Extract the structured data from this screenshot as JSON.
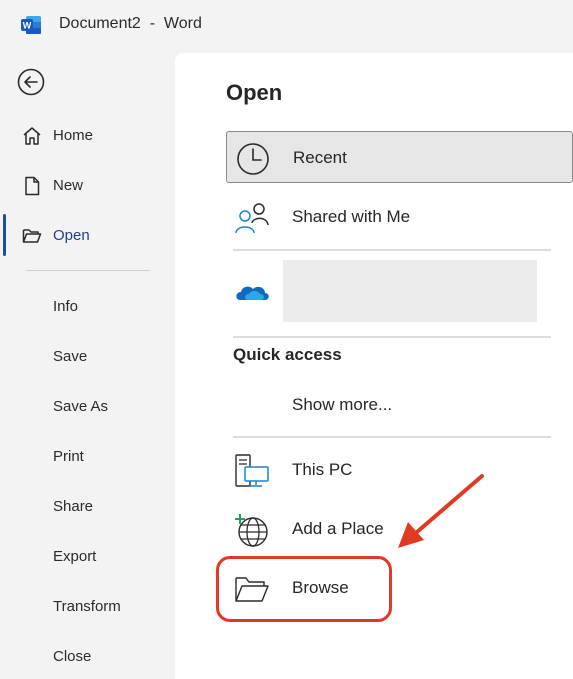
{
  "titlebar": {
    "app_icon": "word-logo-icon",
    "title": "Document2  -  Word"
  },
  "sidebar": {
    "back_icon": "back-arrow-icon",
    "items": [
      {
        "label": "Home",
        "icon": "home-icon"
      },
      {
        "label": "New",
        "icon": "new-document-icon"
      },
      {
        "label": "Open",
        "icon": "open-folder-icon",
        "active": true
      }
    ],
    "sub_items": [
      "Info",
      "Save",
      "Save As",
      "Print",
      "Share",
      "Export",
      "Transform",
      "Close"
    ]
  },
  "main": {
    "heading": "Open",
    "locations": [
      {
        "label": "Recent",
        "icon": "clock-icon",
        "selected": true
      },
      {
        "label": "Shared with Me",
        "icon": "people-icon"
      },
      {
        "label": "",
        "icon": "onedrive-cloud-icon",
        "redacted": true
      }
    ],
    "quick_access": {
      "title": "Quick access",
      "show_more": "Show more..."
    },
    "other_locations": [
      {
        "label": "This PC",
        "icon": "this-pc-icon"
      },
      {
        "label": "Add a Place",
        "icon": "add-place-globe-icon"
      },
      {
        "label": "Browse",
        "icon": "browse-folder-icon",
        "highlighted": true
      }
    ]
  },
  "colors": {
    "accent": "#1f4e9c",
    "annotation": "#e03a22",
    "onedrive": "#0f6cbd"
  }
}
